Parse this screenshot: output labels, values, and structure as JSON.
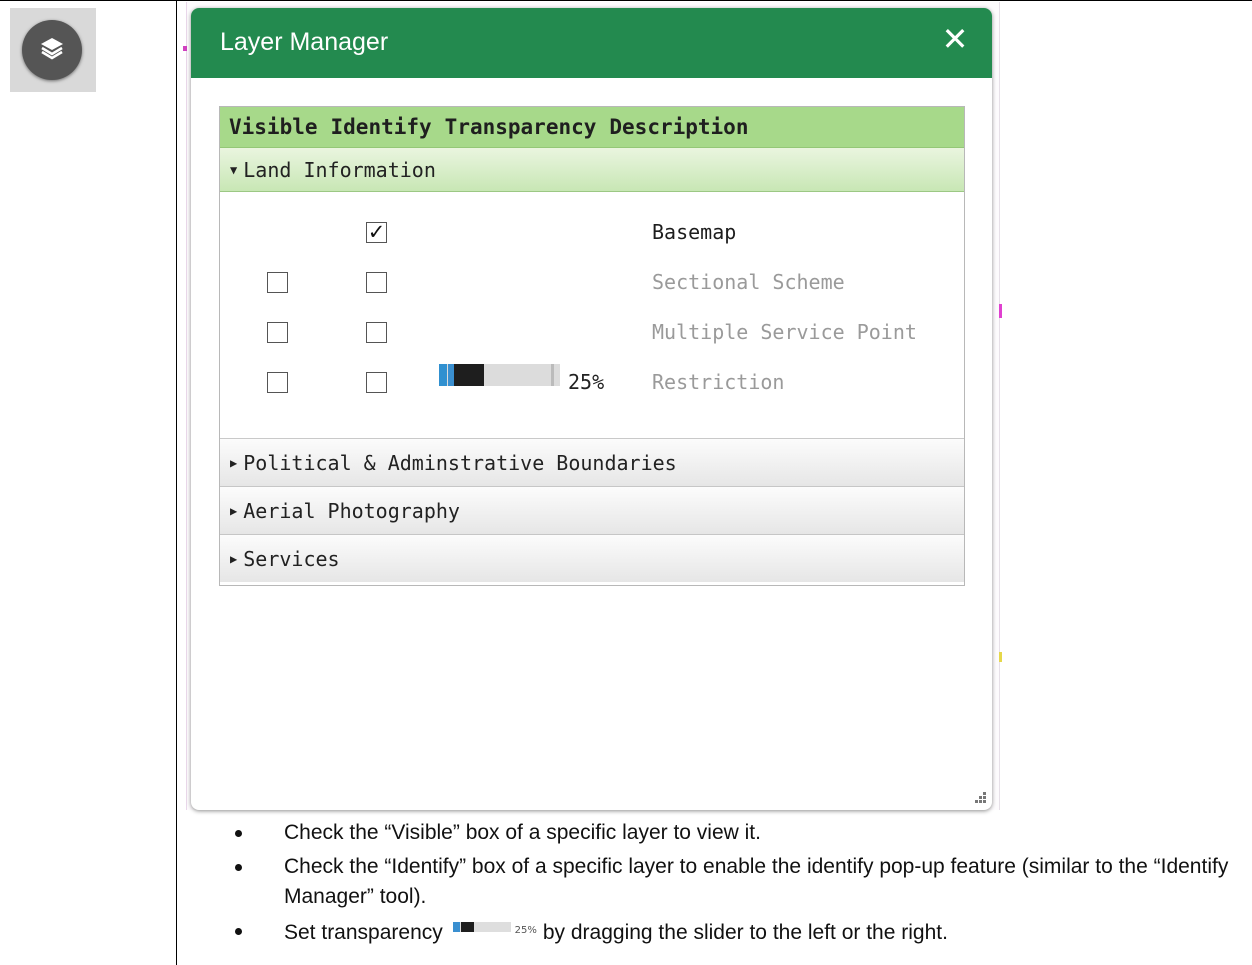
{
  "toolbar": {
    "layers_button_icon": "layers-icon"
  },
  "panel": {
    "title": "Layer Manager",
    "close_glyph": "✕",
    "header_color": "#238a4f",
    "columns": [
      "Visible",
      "Identify",
      "Transparency",
      "Description"
    ],
    "groups": [
      {
        "label": "Land Information",
        "expanded": true,
        "layers": [
          {
            "visible": null,
            "identify": true,
            "transparency": null,
            "description": "Basemap",
            "enabled": true
          },
          {
            "visible": false,
            "identify": false,
            "transparency": null,
            "description": "Sectional Scheme",
            "enabled": false
          },
          {
            "visible": false,
            "identify": false,
            "transparency": null,
            "description": "Multiple Service Point",
            "enabled": false
          },
          {
            "visible": false,
            "identify": false,
            "transparency": "25%",
            "transparency_value": 0.25,
            "description": "Restriction",
            "enabled": false
          }
        ]
      },
      {
        "label": "Political & Adminstrative Boundaries",
        "expanded": false
      },
      {
        "label": "Aerial Photography",
        "expanded": false
      },
      {
        "label": "Services",
        "expanded": false
      }
    ],
    "check_glyph": "✓"
  },
  "instructions": {
    "b1": "Check the “Visible” box of a specific layer to view it.",
    "b2": "Check the “Identify” box of a specific layer to enable the identify pop-up feature (similar to the “Identify Manager” tool).",
    "b3_pre": "Set transparency",
    "b3_pct": "25%",
    "b3_post": "by dragging the slider to the left or the right."
  }
}
